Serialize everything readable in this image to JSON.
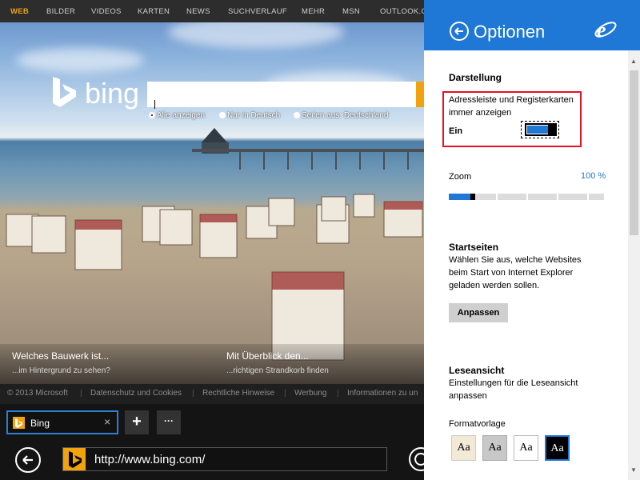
{
  "topnav": {
    "items": [
      "WEB",
      "BILDER",
      "VIDEOS",
      "KARTEN",
      "NEWS",
      "SUCHVERLAUF",
      "MEHR",
      "MSN",
      "OUTLOOK.COM"
    ]
  },
  "bing": {
    "word": "bing",
    "search": {
      "value": "",
      "placeholder": ""
    },
    "radios": [
      "Alle anzeigen",
      "Nur in Deutsch",
      "Seiten aus: Deutschland"
    ]
  },
  "captions": [
    {
      "title": "Welches Bauwerk ist...",
      "sub": "...im Hintergrund zu sehen?"
    },
    {
      "title": "Mit Überblick den...",
      "sub": "...richtigen Strandkorb finden"
    }
  ],
  "footer": {
    "copyright": "© 2013 Microsoft",
    "links": [
      "Datenschutz und Cookies",
      "Rechtliche Hinweise",
      "Werbung",
      "Informationen zu un"
    ]
  },
  "tabbar": {
    "tab_label": "Bing",
    "close_symbol": "×",
    "new_tab_symbol": "+",
    "more_symbol": "···"
  },
  "addressbar": {
    "url": "http://www.bing.com/"
  },
  "options": {
    "title": "Optionen",
    "darstellung": {
      "heading": "Darstellung",
      "setting_text": "Adressleiste und Registerkarten immer anzeigen",
      "toggle_state": "Ein",
      "toggle_on": true
    },
    "zoom": {
      "label": "Zoom",
      "value_text": "100 %",
      "level_fraction": 0.15
    },
    "startseiten": {
      "heading": "Startseiten",
      "description": "Wählen Sie aus, welche Websites beim Start von Internet Explorer geladen werden sollen.",
      "button": "Anpassen"
    },
    "leseansicht": {
      "heading": "Leseansicht",
      "description": "Einstellungen für die Leseansicht anpassen",
      "formatvorlage_label": "Formatvorlage",
      "swatches": [
        "Aa",
        "Aa",
        "Aa",
        "Aa"
      ]
    }
  },
  "colors": {
    "accent": "#1f78d6",
    "bing_orange": "#f0a30a",
    "highlight_red": "#e81123"
  }
}
